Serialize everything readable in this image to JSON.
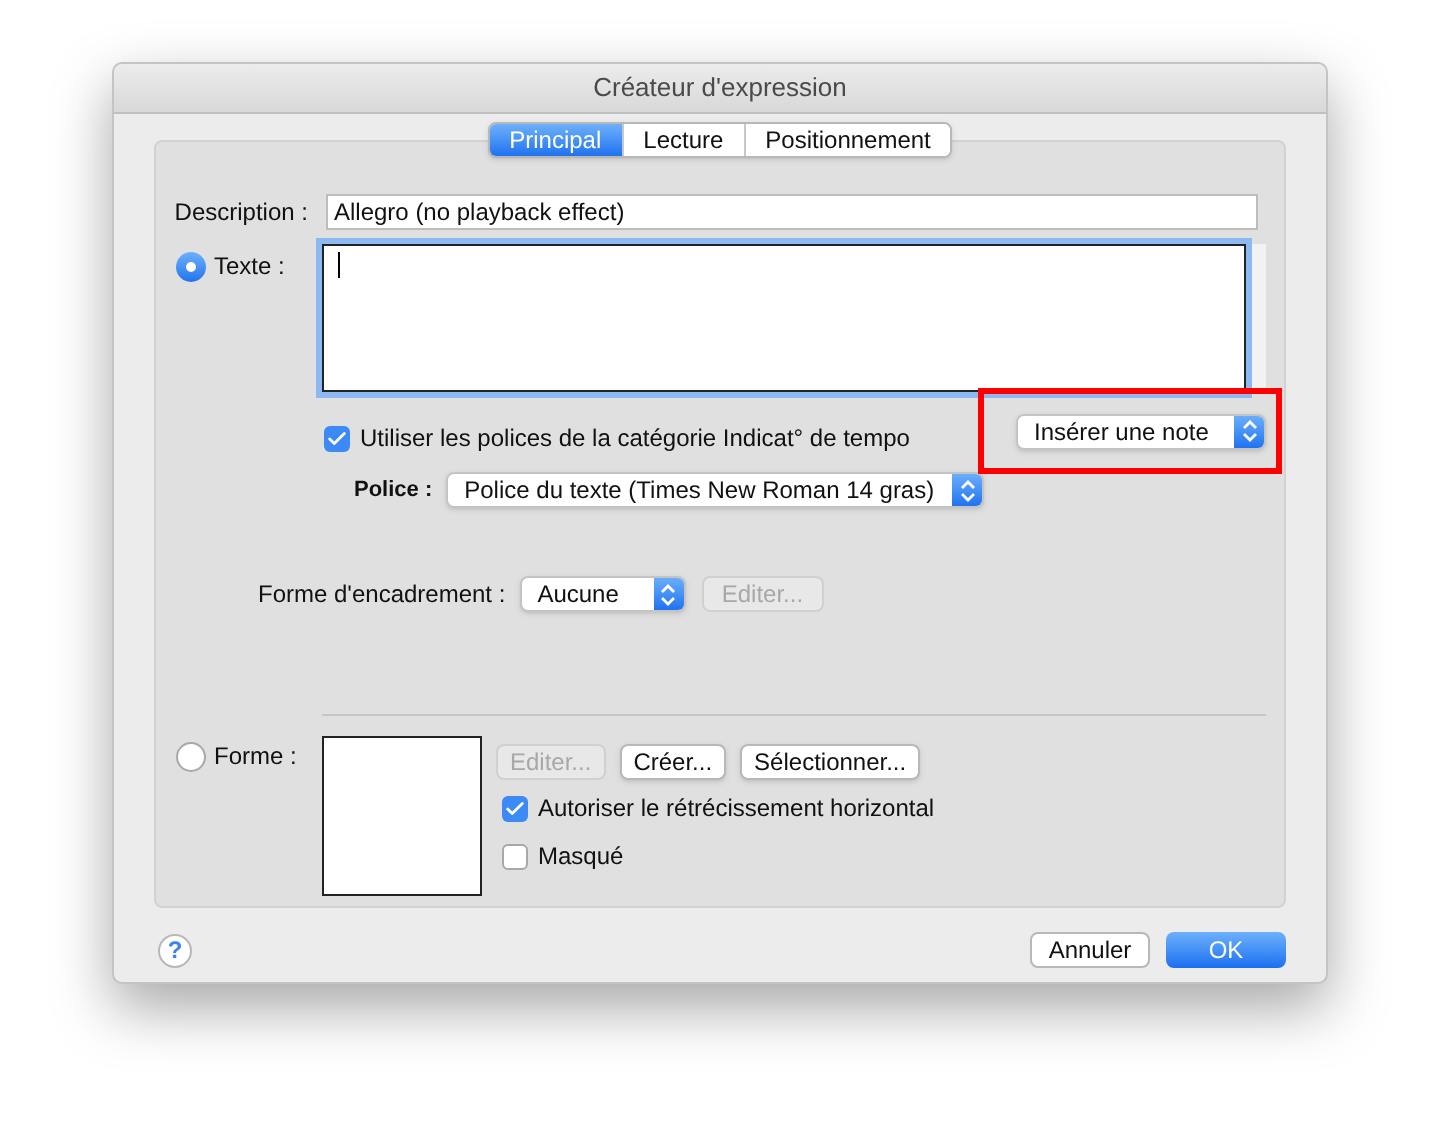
{
  "window": {
    "title": "Créateur d'expression"
  },
  "tabs": [
    {
      "label": "Principal",
      "selected": true
    },
    {
      "label": "Lecture",
      "selected": false
    },
    {
      "label": "Positionnement",
      "selected": false
    }
  ],
  "description": {
    "label": "Description :",
    "value": "Allegro (no playback effect)"
  },
  "text_option": {
    "label": "Texte :",
    "selected": true
  },
  "use_fonts": {
    "label": "Utiliser les polices de la catégorie Indicat° de tempo",
    "checked": true
  },
  "insert_note": {
    "value": "Insérer une note"
  },
  "font": {
    "label": "Police :",
    "value": "Police du texte (Times New Roman 14 gras)"
  },
  "frame": {
    "label": "Forme d'encadrement :",
    "value": "Aucune",
    "edit_button": {
      "label": "Editer...",
      "disabled": true
    }
  },
  "shape_option": {
    "label": "Forme :",
    "selected": false
  },
  "shape_buttons": [
    {
      "label": "Editer...",
      "disabled": true
    },
    {
      "label": "Créer...",
      "disabled": false
    },
    {
      "label": "Sélectionner...",
      "disabled": false
    }
  ],
  "shape_checks": [
    {
      "label": "Autoriser le rétrécissement horizontal",
      "checked": true
    },
    {
      "label": "Masqué",
      "checked": false
    }
  ],
  "help": {
    "label": "?"
  },
  "buttons": [
    {
      "label": "Annuler",
      "default": false
    },
    {
      "label": "OK",
      "default": true
    }
  ]
}
